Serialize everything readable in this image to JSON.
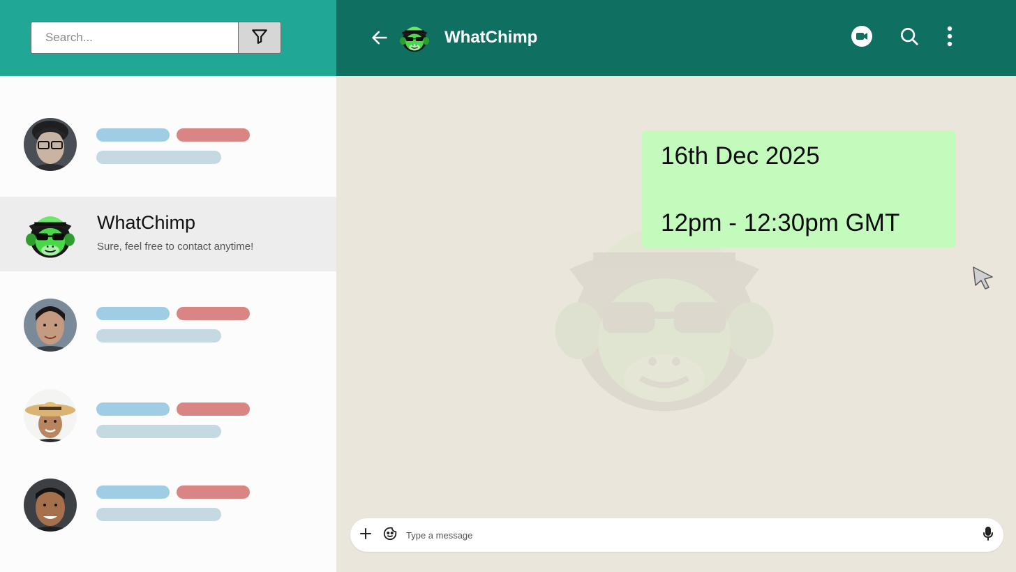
{
  "search": {
    "placeholder": "Search..."
  },
  "icons": {
    "filter": "filter-icon",
    "back": "arrow-left-icon",
    "video": "video-camera-icon",
    "search": "search-icon",
    "menu": "more-vertical-icon",
    "attach": "plus-icon",
    "sticker": "sticker-icon",
    "mic": "microphone-icon"
  },
  "chat_list": [
    {
      "type": "placeholder"
    },
    {
      "type": "contact",
      "name": "WhatChimp",
      "preview": "Sure, feel free to contact anytime!"
    },
    {
      "type": "placeholder"
    },
    {
      "type": "placeholder"
    },
    {
      "type": "placeholder"
    }
  ],
  "header": {
    "title": "WhatChimp"
  },
  "message": {
    "line1": "16th Dec 2025",
    "line2": "12pm - 12:30pm GMT"
  },
  "composer": {
    "placeholder": "Type a message"
  },
  "colors": {
    "left_header": "#21a895",
    "right_header": "#0f7062",
    "bubble": "#c3fbbd",
    "chat_background": "#ebe6db",
    "active_row": "#ededed",
    "bar_blue": "#9ecde4",
    "bar_red": "#d98583",
    "bar_gray": "#c5d9e3"
  }
}
